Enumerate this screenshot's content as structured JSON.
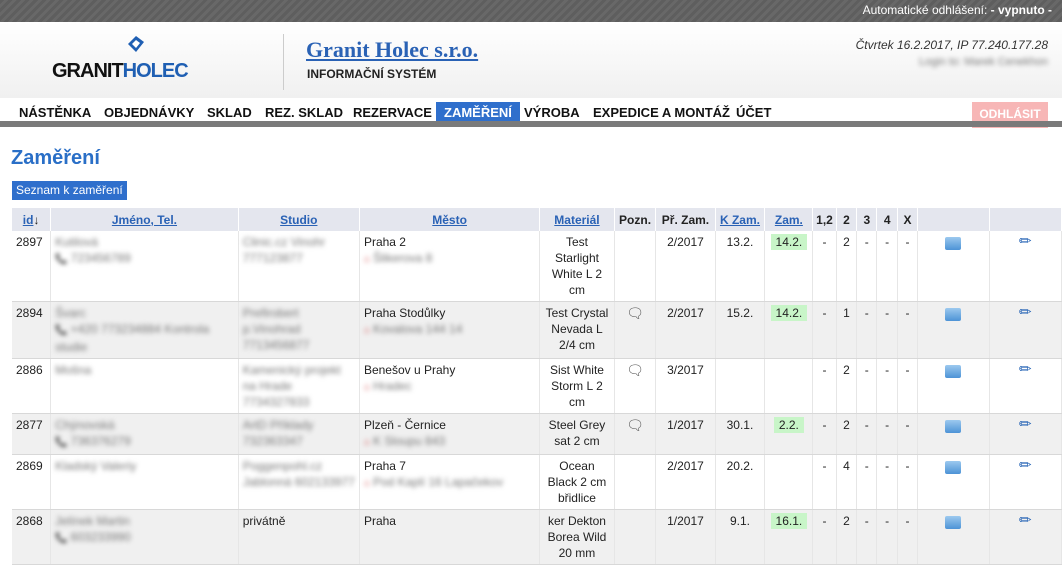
{
  "topbar": {
    "label": "Automatické odhlášení:",
    "value": " - vypnuto -"
  },
  "header": {
    "logo": {
      "part1": "GRANIT",
      "part2": "HOLEC"
    },
    "company": "Granit Holec s.r.o.",
    "subtitle": "INFORMAČNÍ SYSTÉM",
    "date_ip": "Čtvrtek 16.2.2017, IP 77.240.177.28",
    "login": "Login to: Marek Cenekhon"
  },
  "nav": {
    "items": [
      "NÁSTĚNKA",
      "OBJEDNÁVKY",
      "SKLAD",
      "REZ. SKLAD",
      "REZERVACE",
      "ZAMĚŘENÍ",
      "VÝROBA",
      "EXPEDICE A MONTÁŽ",
      "ÚČET"
    ],
    "logout": "ODHLÁSIT"
  },
  "page": {
    "title": "Zaměření",
    "list_button": "Seznam k zaměření"
  },
  "table": {
    "headers": [
      "id",
      "Jméno, Tel.",
      "Studio",
      "Město",
      "Materiál",
      "Pozn.",
      "Př. Zam.",
      "K Zam.",
      "Zam.",
      "1,2",
      "2",
      "3",
      "4",
      "X"
    ],
    "rows": [
      {
        "id": "2897",
        "name": "Kutilová",
        "tel": "723456789",
        "studio": "Clinic.cz Vinohr 777123877",
        "city": "Praha 2",
        "addr": "Šlikerova 8",
        "material": "Test Starlight White L 2 cm",
        "note": "",
        "pr": "2/2017",
        "k": "13.2.",
        "zam": "14.2.",
        "c12": "-",
        "c2": "2",
        "c3": "-",
        "c4": "-",
        "cx": "-"
      },
      {
        "id": "2894",
        "name": "Švarc",
        "tel": "+420 773234884 Kontrola studie",
        "studio": "Prefirobert p.Vinohrad 7713456877",
        "city": "Praha Stodůlky",
        "addr": "Kovalova 144 14",
        "material": "Test Crystal Nevada L 2/4 cm",
        "note": "speech",
        "pr": "2/2017",
        "k": "15.2.",
        "zam": "14.2.",
        "c12": "-",
        "c2": "1",
        "c3": "-",
        "c4": "-",
        "cx": "-"
      },
      {
        "id": "2886",
        "name": "Mošna",
        "tel": "",
        "studio": "Kamenický projekt na Hrade 7734327833",
        "city": "Benešov u Prahy",
        "addr": "Hradec",
        "material": "Sist White Storm L 2 cm",
        "note": "speech",
        "pr": "3/2017",
        "k": "",
        "zam": "",
        "c12": "-",
        "c2": "2",
        "c3": "-",
        "c4": "-",
        "cx": "-"
      },
      {
        "id": "2877",
        "name": "Chýnovská",
        "tel": "736376279",
        "studio": "ArtD Příklady 732363347",
        "city": "Plzeň - Černice",
        "addr": "K Sloupu 843",
        "material": "Steel Grey sat 2 cm",
        "note": "speech",
        "pr": "1/2017",
        "k": "30.1.",
        "zam": "2.2.",
        "c12": "-",
        "c2": "2",
        "c3": "-",
        "c4": "-",
        "cx": "-"
      },
      {
        "id": "2869",
        "name": "Kladský Valeriy",
        "tel": "",
        "studio": "Poggenpohl.cz Jablonná 602133977",
        "city": "Praha 7",
        "addr": "Pod Kaplí 16 Lapačekov",
        "material": "Ocean Black 2 cm břidlice",
        "note": "",
        "pr": "2/2017",
        "k": "20.2.",
        "zam": "",
        "c12": "-",
        "c2": "4",
        "c3": "-",
        "c4": "-",
        "cx": "-"
      },
      {
        "id": "2868",
        "name": "Jelínek Martin",
        "tel": "603233990",
        "studio": "privátně",
        "city": "Praha",
        "addr": "",
        "material": "ker Dekton Borea Wild 20 mm",
        "note": "",
        "pr": "1/2017",
        "k": "9.1.",
        "zam": "16.1.",
        "c12": "-",
        "c2": "2",
        "c3": "-",
        "c4": "-",
        "cx": "-"
      }
    ]
  }
}
